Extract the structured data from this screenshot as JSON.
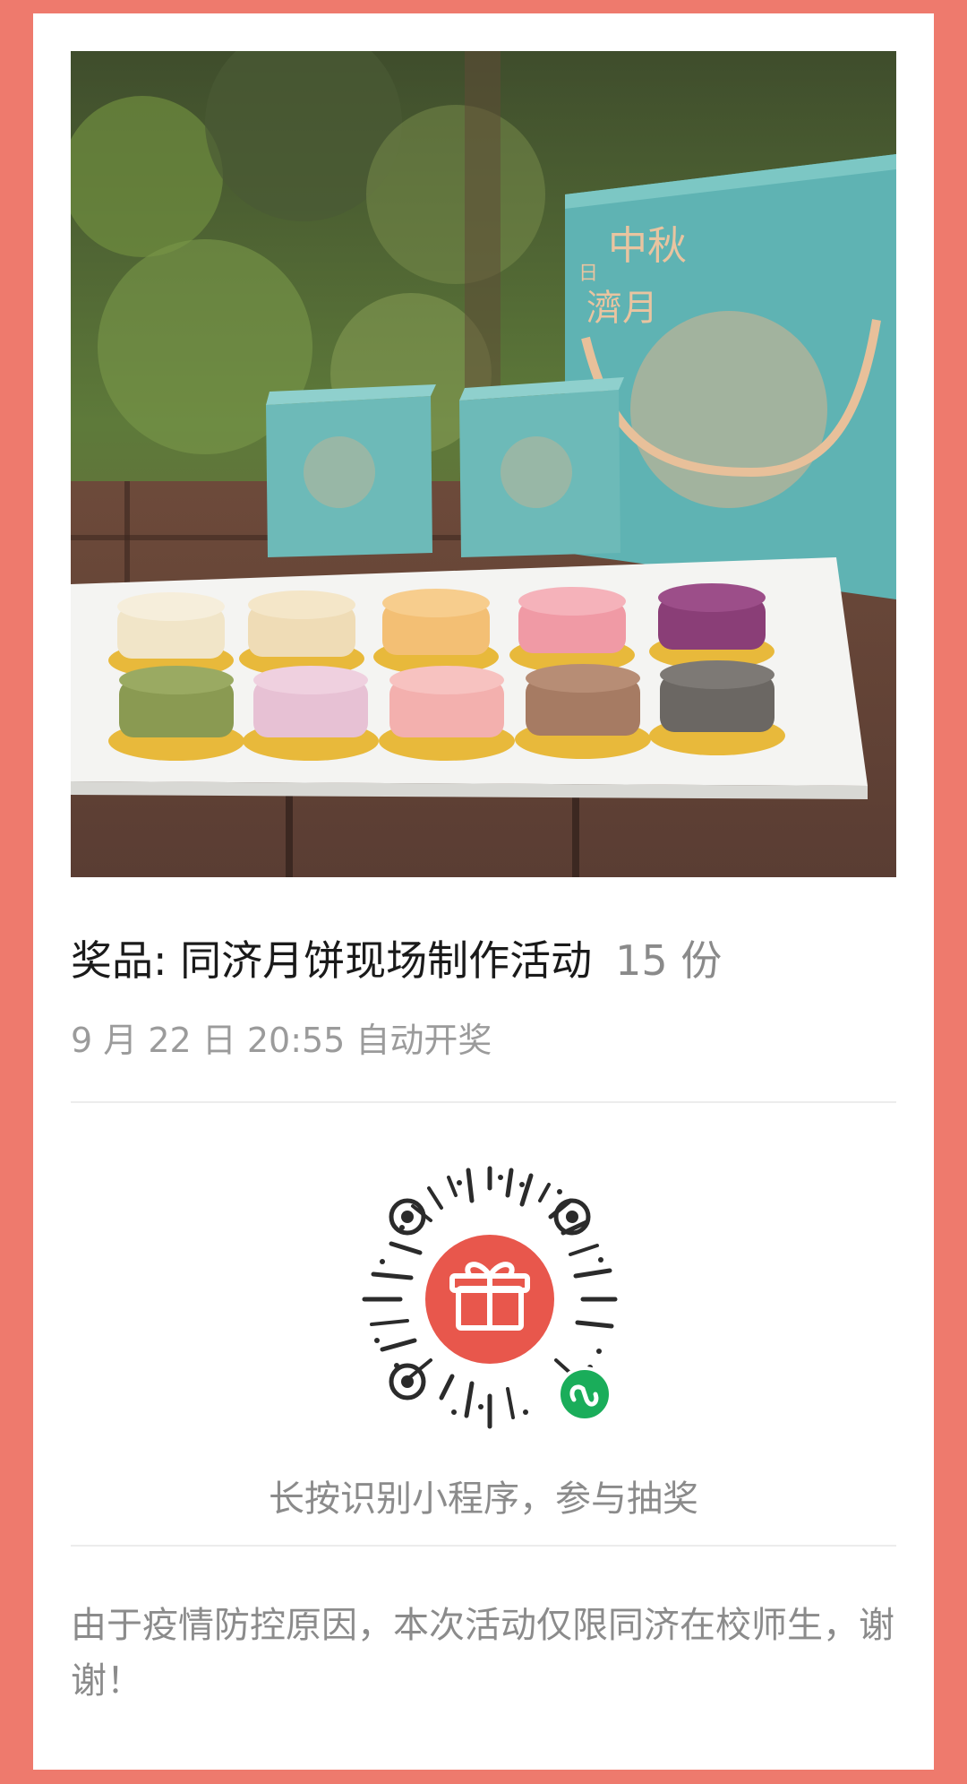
{
  "prize": {
    "title": "奖品: 同济月饼现场制作活动",
    "quantity": "15 份",
    "draw_time": "9 月 22 日 20:55 自动开奖"
  },
  "photo": {
    "box_text_1": "中秋",
    "box_text_2": "濟月",
    "box_text_3": "日"
  },
  "mini_program": {
    "hint": "长按识别小程序，参与抽奖"
  },
  "notice": {
    "text": "由于疫情防控原因，本次活动仅限同济在校师生，谢谢！"
  },
  "colors": {
    "frame": "#ee7a6d",
    "card": "#ffffff",
    "gift_circle": "#e8574c",
    "mini_program_badge": "#1aad5a"
  }
}
